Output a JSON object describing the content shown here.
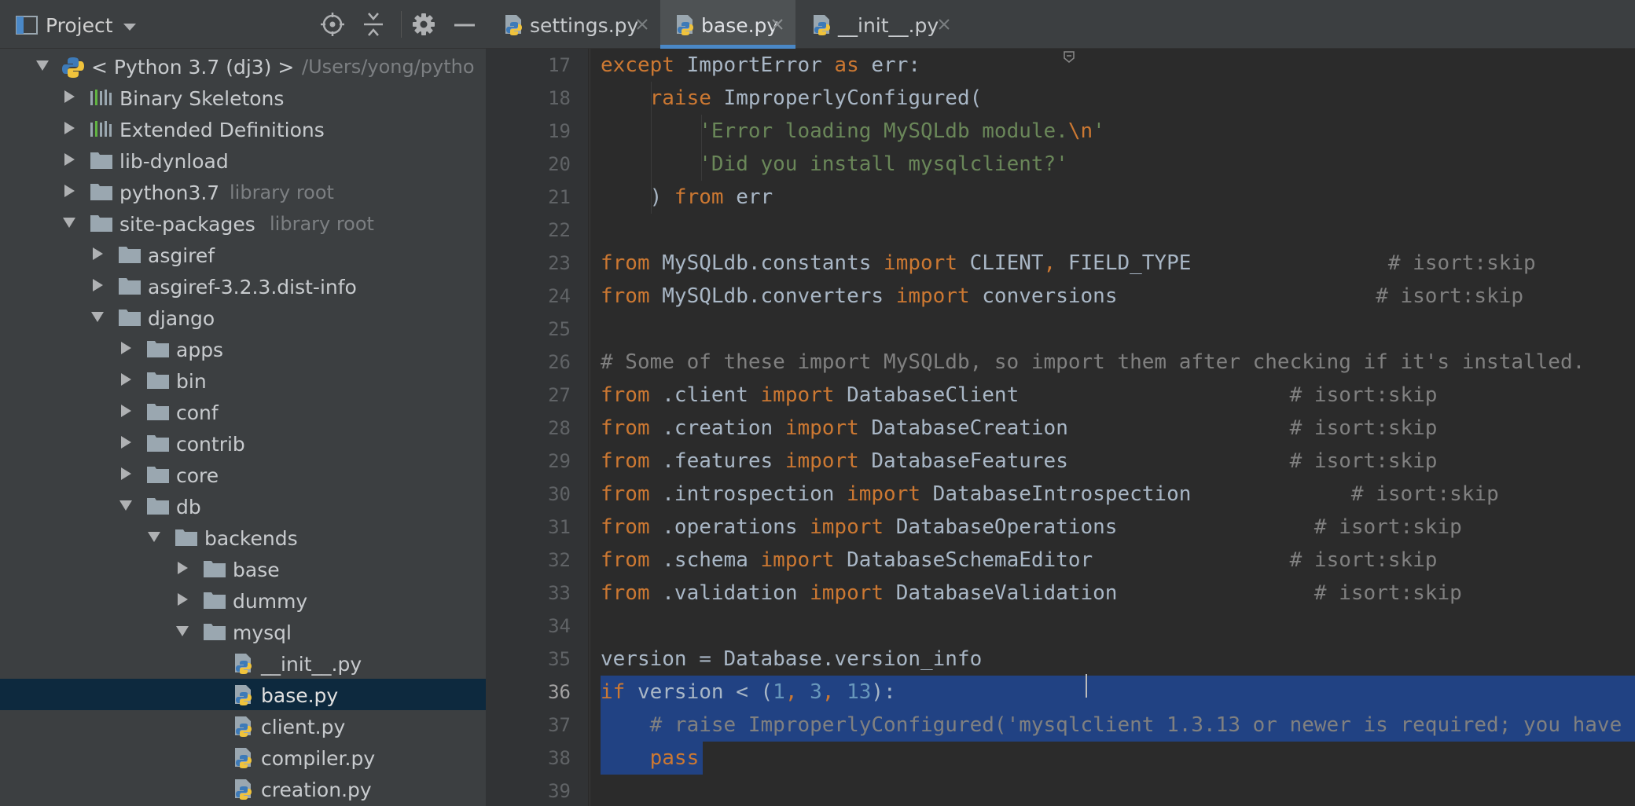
{
  "project_panel": {
    "title": "Project",
    "tree": [
      {
        "label": "< Python 3.7 (dj3) >",
        "hint": "/Users/yong/pytho",
        "icon": "python-icon",
        "expanded": true
      },
      {
        "label": "Binary Skeletons",
        "hint": "",
        "icon": "library-icon",
        "expanded": false
      },
      {
        "label": "Extended Definitions",
        "hint": "",
        "icon": "library-icon",
        "expanded": false
      },
      {
        "label": "lib-dynload",
        "hint": "",
        "icon": "folder-icon",
        "expanded": false
      },
      {
        "label": "python3.7",
        "hint": "library root",
        "icon": "folder-icon",
        "expanded": false
      },
      {
        "label": "site-packages",
        "hint": "library root",
        "icon": "folder-icon",
        "expanded": true
      },
      {
        "label": "asgiref",
        "hint": "",
        "icon": "folder-icon",
        "expanded": false
      },
      {
        "label": "asgiref-3.2.3.dist-info",
        "hint": "",
        "icon": "folder-icon",
        "expanded": false
      },
      {
        "label": "django",
        "hint": "",
        "icon": "folder-icon",
        "expanded": true
      },
      {
        "label": "apps",
        "hint": "",
        "icon": "folder-icon",
        "expanded": false
      },
      {
        "label": "bin",
        "hint": "",
        "icon": "folder-icon",
        "expanded": false
      },
      {
        "label": "conf",
        "hint": "",
        "icon": "folder-icon",
        "expanded": false
      },
      {
        "label": "contrib",
        "hint": "",
        "icon": "folder-icon",
        "expanded": false
      },
      {
        "label": "core",
        "hint": "",
        "icon": "folder-icon",
        "expanded": false
      },
      {
        "label": "db",
        "hint": "",
        "icon": "folder-icon",
        "expanded": true
      },
      {
        "label": "backends",
        "hint": "",
        "icon": "folder-icon",
        "expanded": true
      },
      {
        "label": "base",
        "hint": "",
        "icon": "folder-icon",
        "expanded": false
      },
      {
        "label": "dummy",
        "hint": "",
        "icon": "folder-icon",
        "expanded": false
      },
      {
        "label": "mysql",
        "hint": "",
        "icon": "folder-icon",
        "expanded": true
      },
      {
        "label": "__init__.py",
        "hint": "",
        "icon": "python-file-icon"
      },
      {
        "label": "base.py",
        "hint": "",
        "icon": "python-file-icon",
        "selected": true
      },
      {
        "label": "client.py",
        "hint": "",
        "icon": "python-file-icon"
      },
      {
        "label": "compiler.py",
        "hint": "",
        "icon": "python-file-icon"
      },
      {
        "label": "creation.py",
        "hint": "",
        "icon": "python-file-icon"
      }
    ]
  },
  "tabs": [
    {
      "label": "settings.py",
      "active": false
    },
    {
      "label": "base.py",
      "active": true
    },
    {
      "label": "__init__.py",
      "active": false
    }
  ],
  "editor": {
    "line_numbers": [
      "17",
      "18",
      "19",
      "20",
      "21",
      "22",
      "23",
      "24",
      "25",
      "26",
      "27",
      "28",
      "29",
      "30",
      "31",
      "32",
      "33",
      "34",
      "35",
      "36",
      "37",
      "38",
      "39"
    ],
    "current_line": "36",
    "lines": [
      [
        [
          "k",
          "except "
        ],
        [
          "",
          "ImportError "
        ],
        [
          "k",
          "as "
        ],
        [
          "",
          "err:"
        ]
      ],
      [
        [
          "",
          "    "
        ],
        [
          "k",
          "raise "
        ],
        [
          "",
          "ImproperlyConfigured("
        ]
      ],
      [
        [
          "",
          "        "
        ],
        [
          "s",
          "'Error loading MySQLdb module."
        ],
        [
          "esc",
          "\\n"
        ],
        [
          "s",
          "'"
        ]
      ],
      [
        [
          "",
          "        "
        ],
        [
          "s",
          "'Did you install mysqlclient?'"
        ]
      ],
      [
        [
          "",
          "    ) "
        ],
        [
          "k",
          "from "
        ],
        [
          "",
          "err"
        ]
      ],
      [],
      [
        [
          "k",
          "from "
        ],
        [
          "",
          "MySQLdb.constants "
        ],
        [
          "k",
          "import "
        ],
        [
          "",
          "CLIENT"
        ],
        [
          "k",
          ", "
        ],
        [
          "",
          "FIELD_TYPE                "
        ],
        [
          "c",
          "# isort:skip"
        ]
      ],
      [
        [
          "k",
          "from "
        ],
        [
          "",
          "MySQLdb.converters "
        ],
        [
          "k",
          "import "
        ],
        [
          "",
          "conversions                     "
        ],
        [
          "c",
          "# isort:skip"
        ]
      ],
      [],
      [
        [
          "c",
          "# Some of these import MySQLdb, so import them after checking if it's installed."
        ]
      ],
      [
        [
          "k",
          "from "
        ],
        [
          "",
          ".client "
        ],
        [
          "k",
          "import "
        ],
        [
          "",
          "DatabaseClient                      "
        ],
        [
          "c",
          "# isort:skip"
        ]
      ],
      [
        [
          "k",
          "from "
        ],
        [
          "",
          ".creation "
        ],
        [
          "k",
          "import "
        ],
        [
          "",
          "DatabaseCreation                  "
        ],
        [
          "c",
          "# isort:skip"
        ]
      ],
      [
        [
          "k",
          "from "
        ],
        [
          "",
          ".features "
        ],
        [
          "k",
          "import "
        ],
        [
          "",
          "DatabaseFeatures                  "
        ],
        [
          "c",
          "# isort:skip"
        ]
      ],
      [
        [
          "k",
          "from "
        ],
        [
          "",
          ".introspection "
        ],
        [
          "k",
          "import "
        ],
        [
          "",
          "DatabaseIntrospection             "
        ],
        [
          "c",
          "# isort:skip"
        ]
      ],
      [
        [
          "k",
          "from "
        ],
        [
          "",
          ".operations "
        ],
        [
          "k",
          "import "
        ],
        [
          "",
          "DatabaseOperations                "
        ],
        [
          "c",
          "# isort:skip"
        ]
      ],
      [
        [
          "k",
          "from "
        ],
        [
          "",
          ".schema "
        ],
        [
          "k",
          "import "
        ],
        [
          "",
          "DatabaseSchemaEditor                "
        ],
        [
          "c",
          "# isort:skip"
        ]
      ],
      [
        [
          "k",
          "from "
        ],
        [
          "",
          ".validation "
        ],
        [
          "k",
          "import "
        ],
        [
          "",
          "DatabaseValidation                "
        ],
        [
          "c",
          "# isort:skip"
        ]
      ],
      [],
      [
        [
          "",
          "version = Database.version_info"
        ]
      ],
      [
        [
          "k",
          "if "
        ],
        [
          "",
          "version < ("
        ],
        [
          "n",
          "1"
        ],
        [
          "k",
          ", "
        ],
        [
          "n",
          "3"
        ],
        [
          "k",
          ", "
        ],
        [
          "n",
          "13"
        ],
        [
          "",
          "):"
        ]
      ],
      [
        [
          "",
          "    "
        ],
        [
          "c",
          "# raise ImproperlyConfigured('mysqlclient 1.3.13 or newer is required; you have"
        ]
      ],
      [
        [
          "",
          "    "
        ],
        [
          "k",
          "pass"
        ]
      ],
      []
    ]
  },
  "colors": {
    "keyword": "#cc7832",
    "string": "#6a8759",
    "number": "#6897bb",
    "comment": "#808080",
    "selection": "#214283",
    "tree_selection": "#0d293e"
  }
}
